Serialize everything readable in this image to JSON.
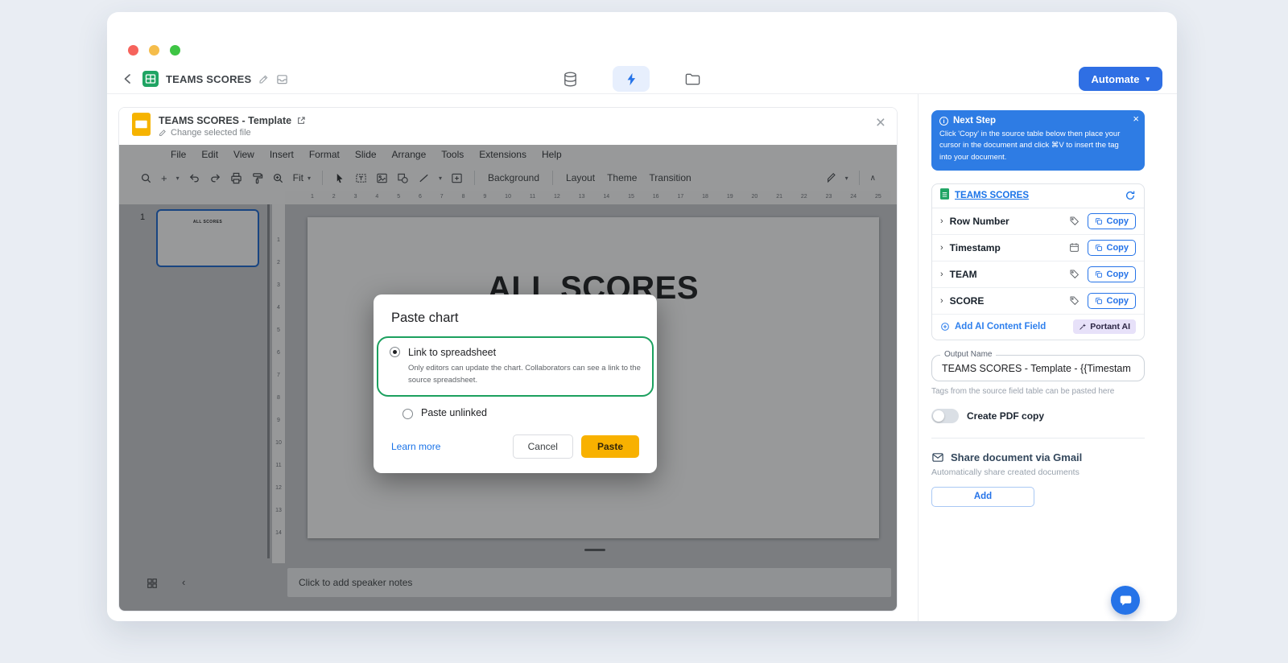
{
  "icons": {
    "caret_down": "▾",
    "close": "×",
    "chevron_right": "›",
    "chevron_left": "‹",
    "chevron_up": "∧",
    "plus": "+",
    "info": "i"
  },
  "topbar": {
    "title": "TEAMS SCORES",
    "automate_label": "Automate"
  },
  "slides": {
    "header": {
      "title": "TEAMS SCORES - Template",
      "change_file_label": "Change selected file"
    },
    "menu": [
      "File",
      "Edit",
      "View",
      "Insert",
      "Format",
      "Slide",
      "Arrange",
      "Tools",
      "Extensions",
      "Help"
    ],
    "toolbar": {
      "fit_label": "Fit",
      "background_label": "Background",
      "layout_label": "Layout",
      "theme_label": "Theme",
      "transition_label": "Transition"
    },
    "ruler_h": [
      "1",
      "2",
      "3",
      "4",
      "5",
      "6",
      "7",
      "8",
      "9",
      "10",
      "11",
      "12",
      "13",
      "14",
      "15",
      "16",
      "17",
      "18",
      "19",
      "20",
      "21",
      "22",
      "23",
      "24",
      "25"
    ],
    "ruler_v": [
      "1",
      "2",
      "3",
      "4",
      "5",
      "6",
      "7",
      "8",
      "9",
      "10",
      "11",
      "12",
      "13",
      "14"
    ],
    "slide_number": "1",
    "thumbnail_title": "ALL SCORES",
    "slide_title": "ALL SCORES",
    "notes_placeholder": "Click to add speaker notes"
  },
  "paste_chart_modal": {
    "title": "Paste chart",
    "options": [
      {
        "label": "Link to spreadsheet",
        "description": "Only editors can update the chart. Collaborators can see a link to the source spreadsheet.",
        "selected": true
      },
      {
        "label": "Paste unlinked",
        "selected": false
      }
    ],
    "learn_more_label": "Learn more",
    "cancel_label": "Cancel",
    "paste_label": "Paste"
  },
  "sidebar": {
    "next_step": {
      "title": "Next Step",
      "body": "Click 'Copy' in the source table below then place your cursor in the document and click ⌘V to insert the tag into your document."
    },
    "source": {
      "name": "TEAMS SCORES",
      "copy_label": "Copy",
      "rows": [
        {
          "label": "Row Number",
          "icon": "tag"
        },
        {
          "label": "Timestamp",
          "icon": "calendar"
        },
        {
          "label": "TEAM",
          "icon": "tag"
        },
        {
          "label": "SCORE",
          "icon": "tag"
        }
      ],
      "add_ai_label": "Add AI Content Field",
      "ai_badge_label": "Portant AI"
    },
    "output": {
      "legend": "Output Name",
      "value": "TEAMS SCORES - Template - {{Timestam",
      "helper": "Tags from the source field table can be pasted here"
    },
    "pdf_label": "Create PDF copy",
    "gmail": {
      "title": "Share document via Gmail",
      "subtitle": "Automatically share created documents",
      "add_label": "Add"
    }
  }
}
